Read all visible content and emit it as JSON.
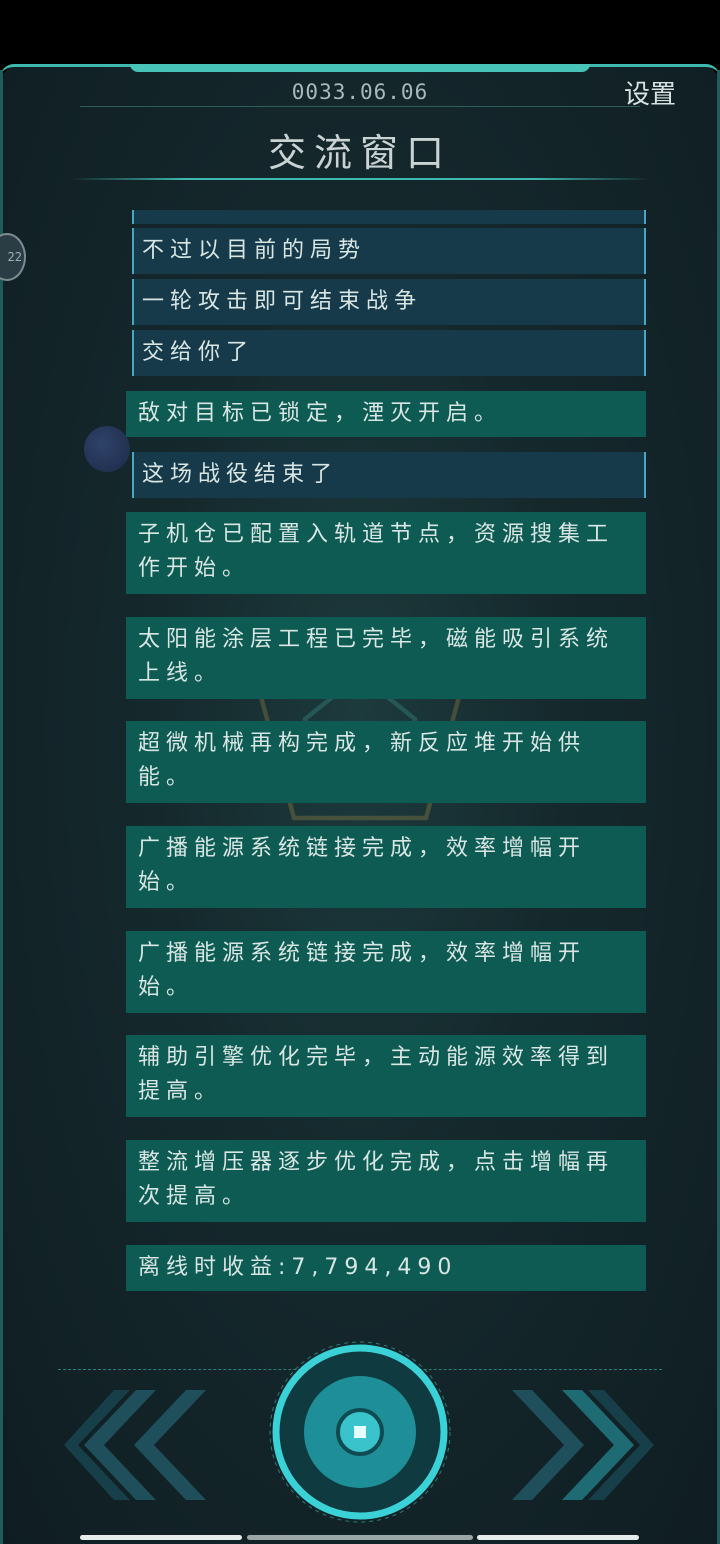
{
  "header": {
    "date": "0033.06.06",
    "settings_label": "设置",
    "title": "交流窗口",
    "side_badge": "22"
  },
  "messages": [
    {
      "text": "不过以目前的局势",
      "style": "dark"
    },
    {
      "text": "一轮攻击即可结束战争",
      "style": "dark"
    },
    {
      "text": "交给你了",
      "style": "dark"
    },
    {
      "text": "敌对目标已锁定，湮灭开启。",
      "style": "teal"
    },
    {
      "text": "这场战役结束了",
      "style": "dark"
    },
    {
      "text": "子机仓已配置入轨道节点，资源搜集工作开始。",
      "style": "teal"
    },
    {
      "text": "太阳能涂层工程已完毕，磁能吸引系统上线。",
      "style": "teal"
    },
    {
      "text": "超微机械再构完成，新反应堆开始供能。",
      "style": "teal"
    },
    {
      "text": "广播能源系统链接完成，效率增幅开始。",
      "style": "teal"
    },
    {
      "text": "广播能源系统链接完成，效率增幅开始。",
      "style": "teal"
    },
    {
      "text": "辅助引擎优化完毕，主动能源效率得到提高。",
      "style": "teal"
    },
    {
      "text": "整流增压器逐步优化完成，点击增幅再次提高。",
      "style": "teal"
    },
    {
      "text": "离线时收益:7,794,490",
      "style": "teal"
    }
  ],
  "colors": {
    "accent": "#3fb8ad",
    "message_teal": "#0e5b54",
    "message_dark": "#173a4a"
  },
  "icons": {
    "prev": "double-chevron-left-icon",
    "next": "double-chevron-right-icon",
    "main": "main-action-button"
  }
}
